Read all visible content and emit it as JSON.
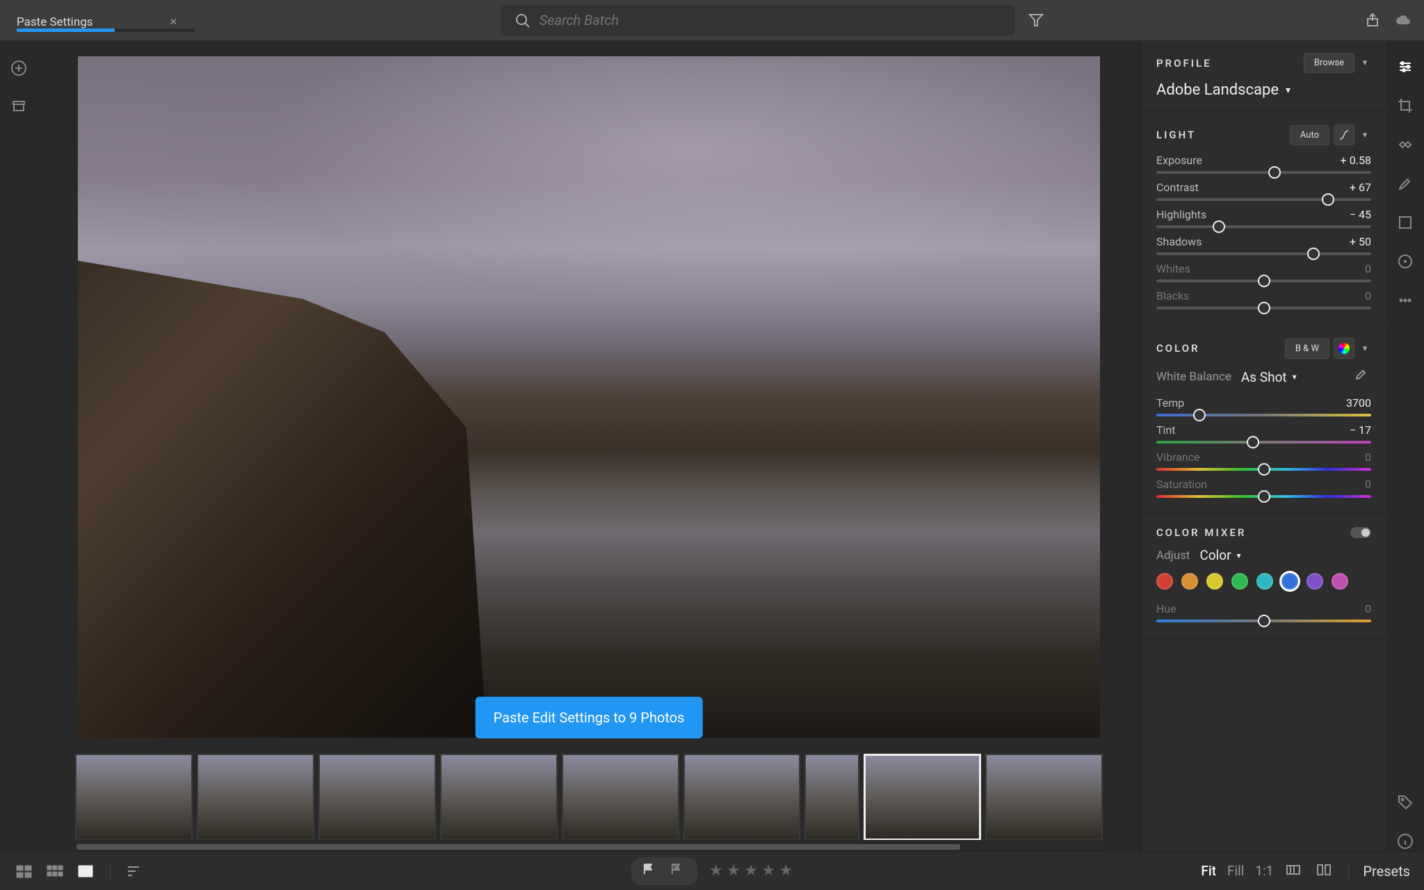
{
  "tab": {
    "title": "Paste Settings",
    "progress_pct": 55
  },
  "search": {
    "placeholder": "Search Batch"
  },
  "profile": {
    "title": "PROFILE",
    "browse": "Browse",
    "name": "Adobe Landscape"
  },
  "light": {
    "title": "LIGHT",
    "auto": "Auto",
    "sliders": [
      {
        "name": "Exposure",
        "value": "+ 0.58",
        "pos": 55,
        "muted": false
      },
      {
        "name": "Contrast",
        "value": "+ 67",
        "pos": 80,
        "muted": false
      },
      {
        "name": "Highlights",
        "value": "− 45",
        "pos": 29,
        "muted": false
      },
      {
        "name": "Shadows",
        "value": "+ 50",
        "pos": 73,
        "muted": false
      },
      {
        "name": "Whites",
        "value": "0",
        "pos": 50,
        "muted": true
      },
      {
        "name": "Blacks",
        "value": "0",
        "pos": 50,
        "muted": true
      }
    ]
  },
  "color": {
    "title": "COLOR",
    "bw": "B & W",
    "wb_label": "White Balance",
    "wb_value": "As Shot",
    "sliders": [
      {
        "name": "Temp",
        "value": "3700",
        "pos": 20,
        "track": "temp",
        "muted": false
      },
      {
        "name": "Tint",
        "value": "− 17",
        "pos": 45,
        "track": "tint",
        "muted": false
      },
      {
        "name": "Vibrance",
        "value": "0",
        "pos": 50,
        "track": "rainbow",
        "muted": true
      },
      {
        "name": "Saturation",
        "value": "0",
        "pos": 50,
        "track": "rainbow",
        "muted": true
      }
    ]
  },
  "mixer": {
    "title": "COLOR MIXER",
    "adjust_label": "Adjust",
    "adjust_value": "Color",
    "hue_label": "Hue",
    "hue_value": "0",
    "swatches": [
      "#d04030",
      "#d89030",
      "#d8c830",
      "#30b850",
      "#30b8c0",
      "#3070d8",
      "#8050c8",
      "#c050b0"
    ],
    "selected_swatch": 5
  },
  "toast": "Paste Edit Settings to 9 Photos",
  "bottom": {
    "fit": "Fit",
    "fill": "Fill",
    "one": "1:1",
    "presets": "Presets"
  }
}
